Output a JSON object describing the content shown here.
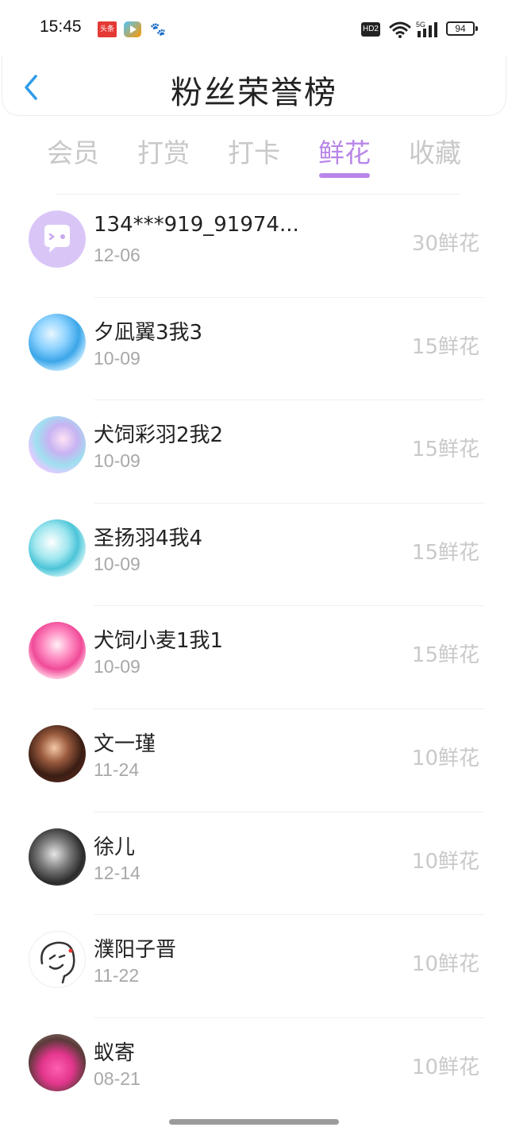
{
  "status_bar": {
    "time": "15:45",
    "toutiao_label": "头条",
    "hd_label": "HD2",
    "network_label": "5G",
    "battery_level": "94"
  },
  "header": {
    "title": "粉丝荣誉榜"
  },
  "tabs": [
    {
      "label": "会员",
      "active": false
    },
    {
      "label": "打赏",
      "active": false
    },
    {
      "label": "打卡",
      "active": false
    },
    {
      "label": "鲜花",
      "active": true
    },
    {
      "label": "收藏",
      "active": false
    }
  ],
  "list": [
    {
      "name": "134***919_91974...",
      "date": "12-06",
      "amount": "30鲜花"
    },
    {
      "name": "夕凪翼3我3",
      "date": "10-09",
      "amount": "15鲜花"
    },
    {
      "name": "犬饲彩羽2我2",
      "date": "10-09",
      "amount": "15鲜花"
    },
    {
      "name": "圣扬羽4我4",
      "date": "10-09",
      "amount": "15鲜花"
    },
    {
      "name": "犬饲小麦1我1",
      "date": "10-09",
      "amount": "15鲜花"
    },
    {
      "name": "文一瑾",
      "date": "11-24",
      "amount": "10鲜花"
    },
    {
      "name": "徐儿",
      "date": "12-14",
      "amount": "10鲜花"
    },
    {
      "name": "濮阳子晋",
      "date": "11-22",
      "amount": "10鲜花"
    },
    {
      "name": "蚁寄",
      "date": "08-21",
      "amount": "10鲜花"
    }
  ],
  "colors": {
    "accent": "#b886e8",
    "back_arrow": "#2f9be8"
  }
}
